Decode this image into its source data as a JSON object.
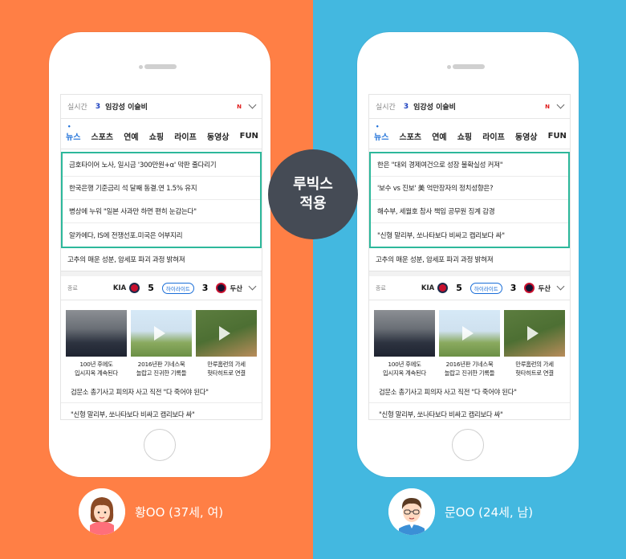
{
  "badge": {
    "line1": "루빅스",
    "line2": "적용"
  },
  "left": {
    "realtime": {
      "label": "실시간",
      "rank": "3",
      "keyword": "임강성 이슬비",
      "logo": "N"
    },
    "tabs": [
      "뉴스",
      "스포츠",
      "연예",
      "쇼핑",
      "라이프",
      "동영상",
      "FUN"
    ],
    "headlines": [
      "금호타이어 노사, 일시금 '300만원+α' 막판 줄다리기",
      "한국은행 기준금리 석 달째 동결.연 1.5% 유지",
      "병상에 누워 \"일본 사과만 하면 편히 눈감는다\"",
      "알카에다, IS에 전쟁선포.미국은 어부지리"
    ],
    "extra_headline": "고추의 매운 성분, 암세포 파괴 과정 밝혀져",
    "score": {
      "status": "종료",
      "team1": "KIA",
      "score1": "5",
      "highlight": "하이라이트",
      "score2": "3",
      "team2": "두산"
    },
    "thumbs": [
      {
        "line1": "100년 후에도",
        "line2": "입시지옥 계속된다"
      },
      {
        "line1": "2016년판 기네스북",
        "line2": "놀랍고 진귀한 기록들"
      },
      {
        "line1": "만루홈런의 가세",
        "line2": "헛타히트로 연결"
      }
    ],
    "bottom": [
      "검문소 총기사고 피의자 사고 직전 \"다 죽어야 된다\"",
      "\"신형 말리부, 쏘나타보다 비싸고 캡리보다 싸\""
    ]
  },
  "right": {
    "realtime": {
      "label": "실시간",
      "rank": "3",
      "keyword": "임강성 이슬비",
      "logo": "N"
    },
    "tabs": [
      "뉴스",
      "스포츠",
      "연예",
      "쇼핑",
      "라이프",
      "동영상",
      "FUN"
    ],
    "headlines": [
      "한은 \"대외 경제여건으로 성장 불확실성 커져\"",
      "'보수 vs 진보' 美 억만장자의 정치성향은?",
      "해수부, 세월호 참사 책임 공무원 징계 감경",
      "\"신형 말리부, 쏘나타보다 비싸고 캡리보다 싸\""
    ],
    "extra_headline": "고추의 매운 성분, 암세포 파괴 과정 밝혀져",
    "score": {
      "status": "종료",
      "team1": "KIA",
      "score1": "5",
      "highlight": "하이라이트",
      "score2": "3",
      "team2": "두산"
    },
    "thumbs": [
      {
        "line1": "100년 후에도",
        "line2": "입시지옥 계속된다"
      },
      {
        "line1": "2016년판 기네스북",
        "line2": "놀랍고 진귀한 기록들"
      },
      {
        "line1": "만루홈런의 가세",
        "line2": "헛타히트로 연결"
      }
    ],
    "bottom": [
      "검문소 총기사고 피의자 사고 직전 \"다 죽어야 된다\"",
      "\"신형 말리부, 쏘나타보다 비싸고 캡리보다 싸\""
    ]
  },
  "persons": {
    "left": "황OO (37세, 여)",
    "right": "문OO (24세, 남)"
  },
  "colors": {
    "left_bg": "#ff7f45",
    "right_bg": "#43b8e0",
    "highlight_box": "#2db89b",
    "badge": "#454b55"
  }
}
